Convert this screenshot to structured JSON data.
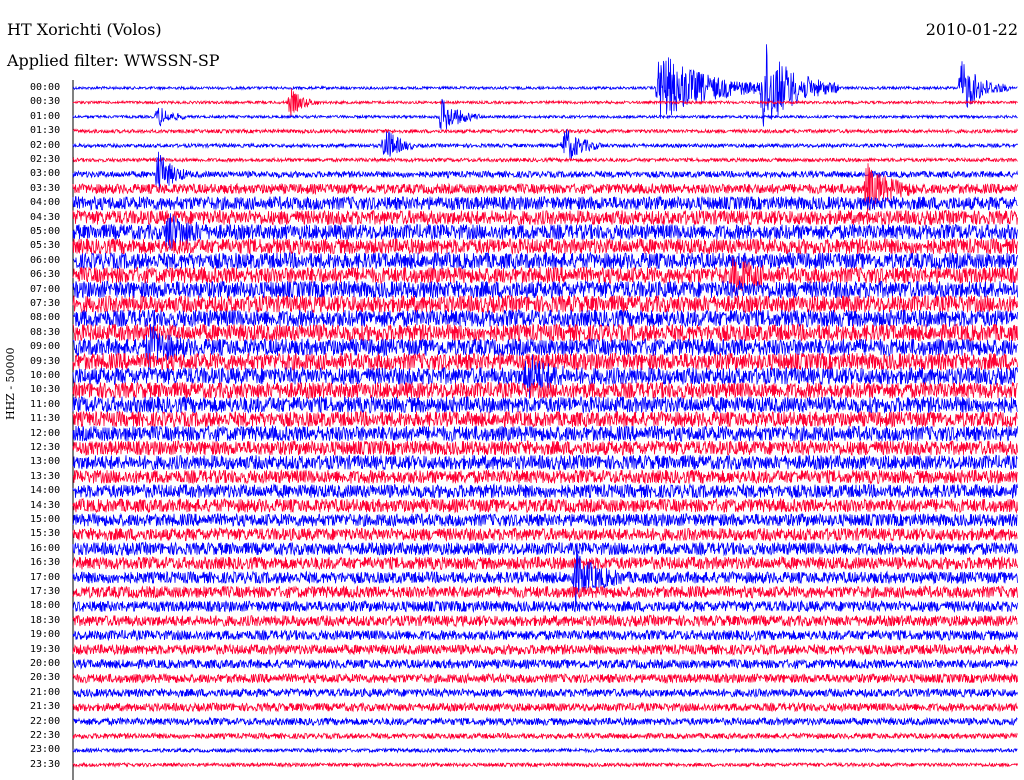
{
  "header": {
    "station": "HT Xorichti (Volos)",
    "filter": "Applied filter: WWSSN-SP",
    "date": "2010-01-22",
    "channel": "HHZ - 50000"
  },
  "colors": {
    "odd": "#ff0033",
    "even": "#0000ff"
  },
  "chart_data": {
    "type": "line",
    "title": "HT Xorichti (Volos)",
    "subtitle": "Applied filter: WWSSN-SP",
    "ylabel": "HHZ - 50000",
    "xlabel": "",
    "rows": [
      "00:00",
      "00:30",
      "01:00",
      "01:30",
      "02:00",
      "02:30",
      "03:00",
      "03:30",
      "04:00",
      "04:30",
      "05:00",
      "05:30",
      "06:00",
      "06:30",
      "07:00",
      "07:30",
      "08:00",
      "08:30",
      "09:00",
      "09:30",
      "10:00",
      "10:30",
      "11:00",
      "11:30",
      "12:00",
      "12:30",
      "13:00",
      "13:30",
      "14:00",
      "14:30",
      "15:00",
      "15:30",
      "16:00",
      "16:30",
      "17:00",
      "17:30",
      "18:00",
      "18:30",
      "19:00",
      "19:30",
      "20:00",
      "20:30",
      "21:00",
      "21:30",
      "22:00",
      "22:30",
      "23:00",
      "23:30"
    ],
    "series_colors": [
      "red",
      "blue"
    ],
    "row_noise_level": [
      0.15,
      0.15,
      0.15,
      0.2,
      0.2,
      0.2,
      0.35,
      0.55,
      0.75,
      0.8,
      0.85,
      0.85,
      0.9,
      0.9,
      0.95,
      0.95,
      0.95,
      0.95,
      0.95,
      0.95,
      0.95,
      0.9,
      0.9,
      0.85,
      0.85,
      0.8,
      0.8,
      0.75,
      0.75,
      0.75,
      0.7,
      0.7,
      0.7,
      0.7,
      0.65,
      0.65,
      0.6,
      0.6,
      0.55,
      0.55,
      0.5,
      0.5,
      0.45,
      0.45,
      0.4,
      0.3,
      0.2,
      0.2
    ],
    "events": [
      {
        "row": 0,
        "t": 0.62,
        "amp": 4,
        "dur": 0.12
      },
      {
        "row": 0,
        "t": 0.73,
        "amp": 5,
        "dur": 0.08
      },
      {
        "row": 0,
        "t": 0.94,
        "amp": 3,
        "dur": 0.05
      },
      {
        "row": 1,
        "t": 0.23,
        "amp": 1.5,
        "dur": 0.03
      },
      {
        "row": 2,
        "t": 0.09,
        "amp": 1.2,
        "dur": 0.03
      },
      {
        "row": 2,
        "t": 0.39,
        "amp": 2,
        "dur": 0.04
      },
      {
        "row": 4,
        "t": 0.33,
        "amp": 2.2,
        "dur": 0.03
      },
      {
        "row": 4,
        "t": 0.52,
        "amp": 2,
        "dur": 0.04
      },
      {
        "row": 6,
        "t": 0.09,
        "amp": 2.5,
        "dur": 0.03
      },
      {
        "row": 7,
        "t": 0.84,
        "amp": 2.5,
        "dur": 0.05
      },
      {
        "row": 10,
        "t": 0.1,
        "amp": 2,
        "dur": 0.04
      },
      {
        "row": 13,
        "t": 0.7,
        "amp": 1.8,
        "dur": 0.04
      },
      {
        "row": 18,
        "t": 0.08,
        "amp": 2,
        "dur": 0.04
      },
      {
        "row": 20,
        "t": 0.48,
        "amp": 2.2,
        "dur": 0.04
      },
      {
        "row": 34,
        "t": 0.53,
        "amp": 2.5,
        "dur": 0.05
      }
    ]
  }
}
